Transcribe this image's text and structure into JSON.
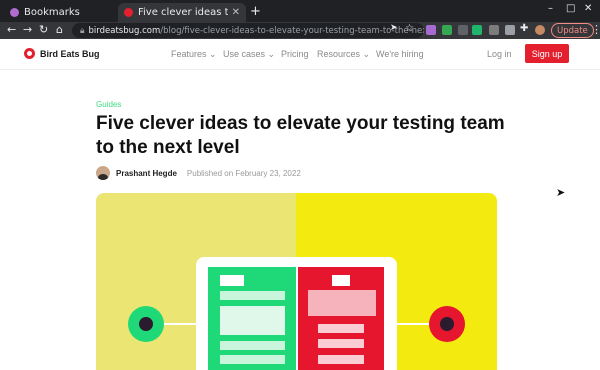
{
  "browser": {
    "tabs": [
      {
        "label": "Bookmarks",
        "active": false,
        "icon": "purple-heart-icon"
      },
      {
        "label": "Five clever ideas to elevat",
        "active": true,
        "icon": "bird-eats-bug-favicon"
      }
    ],
    "new_tab": "+",
    "window_controls": {
      "minimize": "–",
      "maximize": "□",
      "close": "✕"
    },
    "url": {
      "host": "birdeatsbug.com",
      "path": "/blog/five-clever-ideas-to-elevate-your-testing-team-to-the-next-level"
    },
    "update_label": "Update"
  },
  "site": {
    "brand": "Bird Eats Bug",
    "menu": [
      "Features ⌄",
      "Use cases ⌄",
      "Pricing",
      "Resources ⌄",
      "We're hiring"
    ],
    "login": "Log in",
    "signup": "Sign up",
    "brand_color": "#e5202e"
  },
  "article": {
    "category": "Guides",
    "title": "Five clever ideas to elevate your testing team to the next level",
    "author": "Prashant Hegde",
    "published": "Published on February 23, 2022"
  },
  "colors": {
    "accent_green": "#3ddc84",
    "hero_left": "#ebe673",
    "hero_right": "#f3ea10",
    "card_green": "#1fd878",
    "card_red": "#e5162e"
  }
}
